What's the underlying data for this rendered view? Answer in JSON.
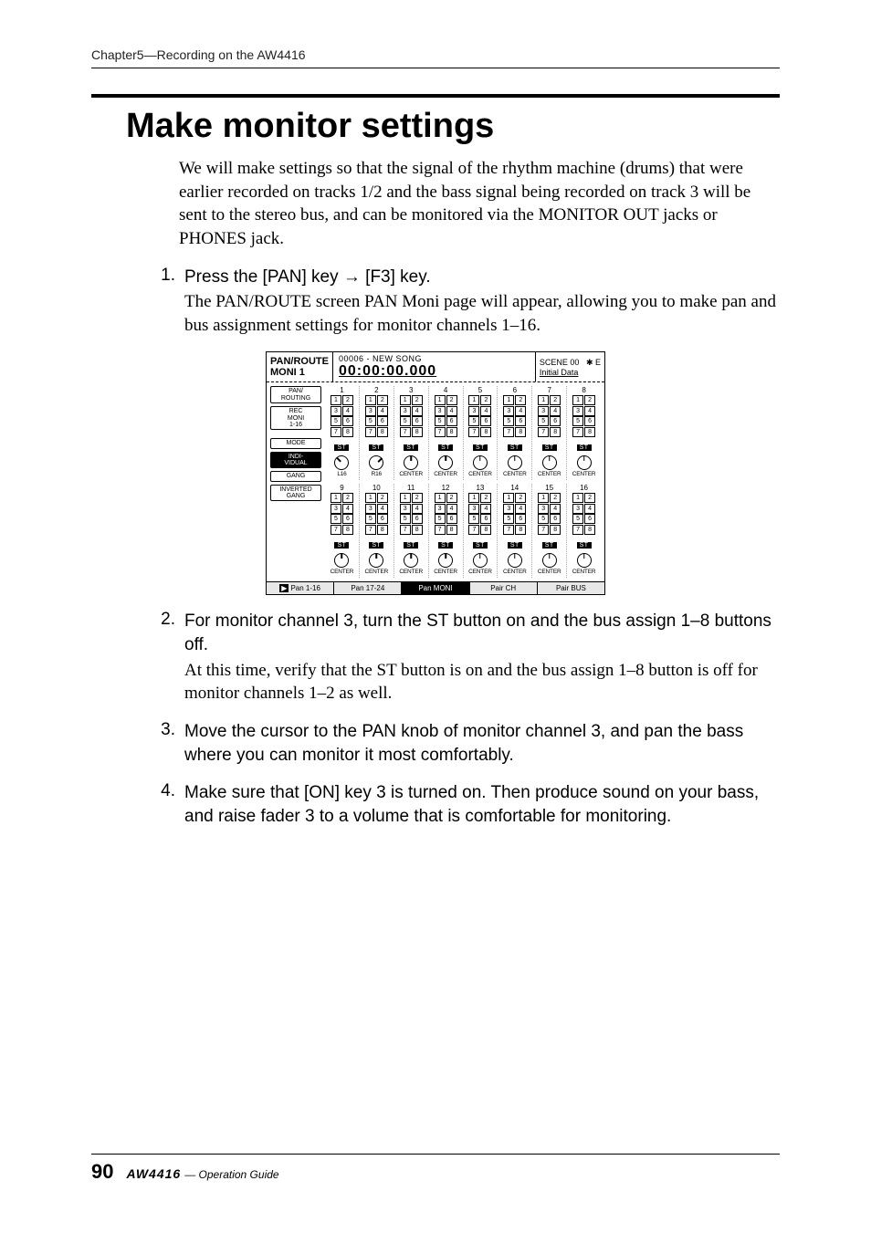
{
  "header": {
    "text": "Chapter5—Recording on the AW4416"
  },
  "title": "Make monitor settings",
  "intro": "We will make settings so that the signal of the rhythm machine (drums) that were earlier recorded on tracks 1/2 and the bass signal being recorded on track 3 will be sent to the stereo bus, and can be monitored via the MONITOR OUT jacks or PHONES jack.",
  "steps": [
    {
      "num": "1.",
      "head_a": "Press the [PAN] key ",
      "arrow": "→",
      "head_b": " [F3] key.",
      "detail": "The PAN/ROUTE screen PAN Moni page will appear, allowing you to make pan and bus assignment settings for monitor channels 1–16."
    },
    {
      "num": "2.",
      "head_a": "For monitor channel 3, turn the ST button on and the bus assign 1–8 buttons off.",
      "detail": "At this time, verify that the ST button is on and the bus assign 1–8 button is off for monitor channels 1–2 as well."
    },
    {
      "num": "3.",
      "head_a": "Move the cursor to the PAN knob of monitor channel 3, and pan the bass where you can monitor it most comfortably."
    },
    {
      "num": "4.",
      "head_a": "Make sure that [ON] key 3 is turned on. Then produce sound on your bass, and raise fader 3 to a volume that is comfortable for monitoring."
    }
  ],
  "screen": {
    "title_left_a": "PAN/ROUTE",
    "title_left_b": "MONI 1",
    "song_meta": "00006 - NEW SONG",
    "timecode": "00:00:00.000",
    "scene": "SCENE 00",
    "scene_icons": "✱ E",
    "scene_sub": "Initial Data",
    "side": [
      {
        "label": "PAN/\nROUTING",
        "sel": false
      },
      {
        "label": "REC\nMONI\n1-16",
        "sel": false
      },
      {
        "label": "MODE",
        "sel": false
      },
      {
        "label": "INDI-\nVIDUAL",
        "sel": true
      },
      {
        "label": "GANG",
        "sel": false
      },
      {
        "label": "INVERTED\nGANG",
        "sel": false
      }
    ],
    "row1": {
      "channels": [
        {
          "num": "1",
          "pan": "L16",
          "knob": "left"
        },
        {
          "num": "2",
          "pan": "R16",
          "knob": "right"
        },
        {
          "num": "3",
          "pan": "CENTER",
          "knob": "center"
        },
        {
          "num": "4",
          "pan": "CENTER",
          "knob": "center"
        },
        {
          "num": "5",
          "pan": "CENTER",
          "knob": "center"
        },
        {
          "num": "6",
          "pan": "CENTER",
          "knob": "center"
        },
        {
          "num": "7",
          "pan": "CENTER",
          "knob": "center"
        },
        {
          "num": "8",
          "pan": "CENTER",
          "knob": "center"
        }
      ]
    },
    "row2": {
      "channels": [
        {
          "num": "9",
          "pan": "CENTER",
          "knob": "center"
        },
        {
          "num": "10",
          "pan": "CENTER",
          "knob": "center"
        },
        {
          "num": "11",
          "pan": "CENTER",
          "knob": "center"
        },
        {
          "num": "12",
          "pan": "CENTER",
          "knob": "center"
        },
        {
          "num": "13",
          "pan": "CENTER",
          "knob": "center"
        },
        {
          "num": "14",
          "pan": "CENTER",
          "knob": "center"
        },
        {
          "num": "15",
          "pan": "CENTER",
          "knob": "center"
        },
        {
          "num": "16",
          "pan": "CENTER",
          "knob": "center"
        }
      ]
    },
    "bus_rows": [
      [
        "1",
        "2"
      ],
      [
        "3",
        "4"
      ],
      [
        "5",
        "6"
      ],
      [
        "7",
        "8"
      ]
    ],
    "st_label": "ST",
    "tabs": [
      {
        "label": "Pan 1-16",
        "sel": false
      },
      {
        "label": "Pan 17-24",
        "sel": false
      },
      {
        "label": "Pan MONI",
        "sel": true
      },
      {
        "label": "Pair CH",
        "sel": false
      },
      {
        "label": "Pair BUS",
        "sel": false
      }
    ]
  },
  "footer": {
    "page": "90",
    "model": "AW4416",
    "guide": "— Operation Guide"
  }
}
